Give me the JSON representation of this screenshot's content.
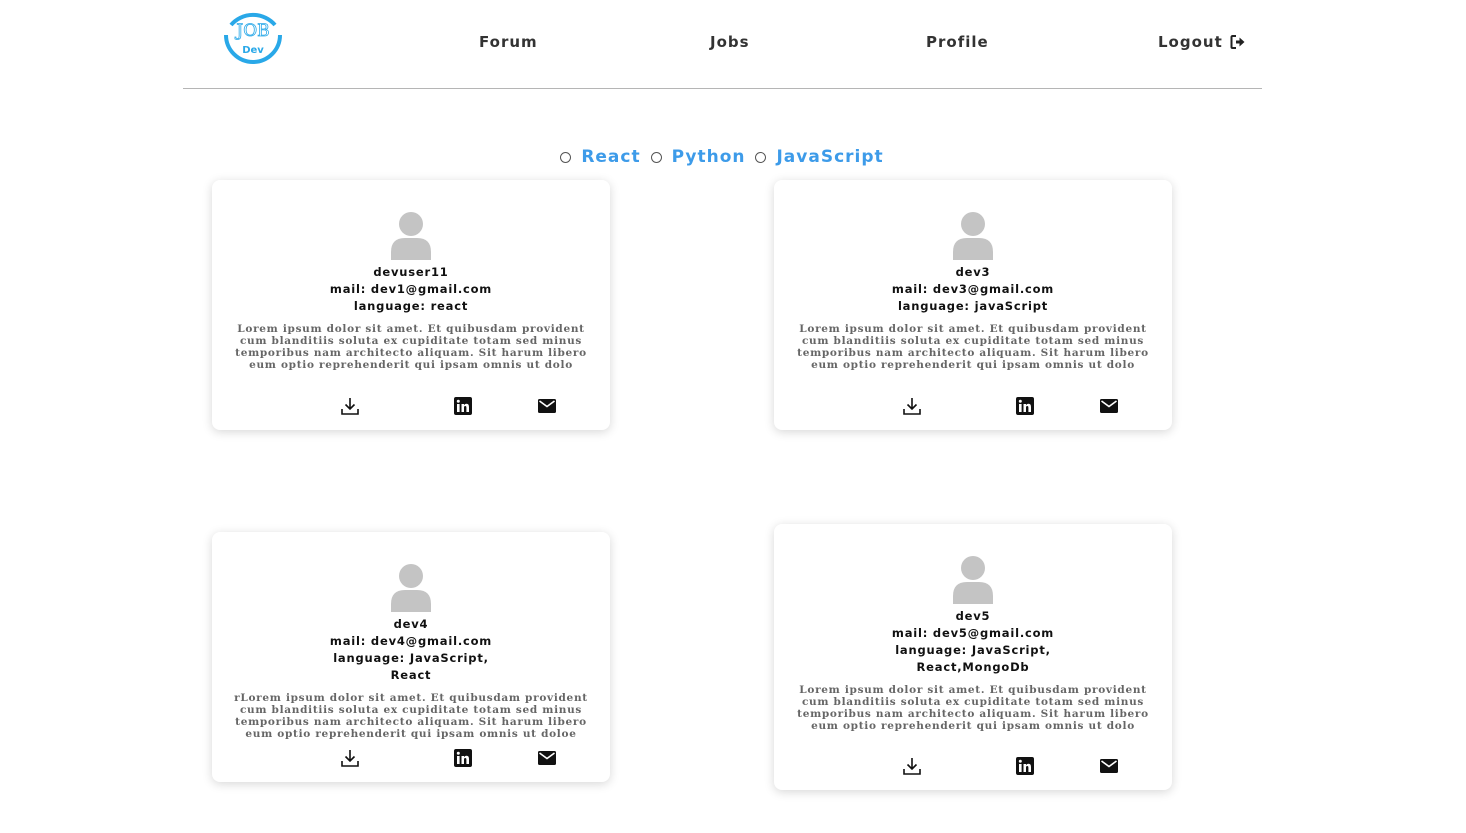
{
  "header": {
    "logo_top": "JOB",
    "logo_bottom": "Dev",
    "nav": {
      "forum": "Forum",
      "jobs": "Jobs",
      "profile": "Profile",
      "logout": "Logout"
    }
  },
  "filter": {
    "options": [
      "React",
      "Python",
      "JavaScript"
    ]
  },
  "colors": {
    "accent": "#3d9be9",
    "logo": "#29a8e8",
    "avatar": "#c4c4c4"
  },
  "cards": [
    {
      "name": "devuser11",
      "mail": "mail: dev1@gmail.com",
      "language": "language: react",
      "bio": "Lorem ipsum dolor sit amet. Et quibusdam provident cum blanditiis soluta ex cupiditate totam sed minus temporibus nam architecto aliquam. Sit harum libero eum optio reprehenderit qui ipsam omnis ut dolo"
    },
    {
      "name": "dev3",
      "mail": "mail: dev3@gmail.com",
      "language": "language: javaScript",
      "bio": "Lorem ipsum dolor sit amet. Et quibusdam provident cum blanditiis soluta ex cupiditate totam sed minus temporibus nam architecto aliquam. Sit harum libero eum optio reprehenderit qui ipsam omnis ut dolo"
    },
    {
      "name": "dev4",
      "mail": "mail: dev4@gmail.com",
      "language": "language: JavaScript, React",
      "bio": "rLorem ipsum dolor sit amet. Et quibusdam provident cum blanditiis soluta ex cupiditate totam sed minus temporibus nam architecto aliquam. Sit harum libero eum optio reprehenderit qui ipsam omnis ut doloe"
    },
    {
      "name": "dev5",
      "mail": "mail: dev5@gmail.com",
      "language": "language: JavaScript, React,MongoDb",
      "bio": "Lorem ipsum dolor sit amet. Et quibusdam provident cum blanditiis soluta ex cupiditate totam sed minus temporibus nam architecto aliquam. Sit harum libero eum optio reprehenderit qui ipsam omnis ut dolo"
    }
  ],
  "icons": {
    "logout": "sign-out-icon",
    "download": "download-icon",
    "linkedin": "linkedin-icon",
    "mail": "mail-icon",
    "avatar": "user-avatar-icon"
  }
}
